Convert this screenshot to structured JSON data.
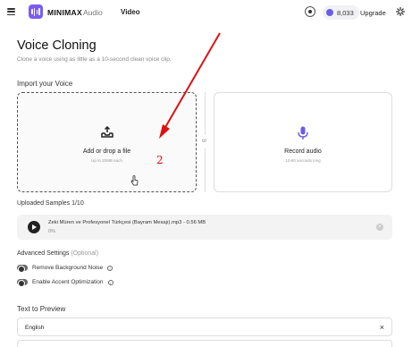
{
  "header": {
    "brand": "MINIMAX",
    "product": "Audio",
    "nav_video": "Video",
    "credits": "8,033",
    "upgrade_label": "Upgrade"
  },
  "page": {
    "title": "Voice Cloning",
    "subtitle": "Clone a voice using as little as a 10-second clean voice clip."
  },
  "import": {
    "label": "Import your Voice",
    "upload_title": "Add or drop a file",
    "upload_sub": "Up to 20MB each",
    "or_text": "or",
    "record_title": "Record audio",
    "record_sub": "10-60 seconds long"
  },
  "annotation": {
    "number": "2",
    "color": "#dd1111"
  },
  "uploaded": {
    "label": "Uploaded Samples  1/10",
    "file_name": "Zeki Müren ve Profesyonel Türkçesi (Bayram Mesajı).mp3 - 0.56 MB",
    "progress_text": "0%"
  },
  "advanced": {
    "label": "Advanced Settings",
    "optional": "(Optional)",
    "option1": "Remove Background Noise",
    "option2": "Enable Accent Optimization"
  },
  "preview": {
    "label": "Text to Preview",
    "language": "English",
    "clear_icon": "×"
  },
  "colors": {
    "accent": "#7a5cf2",
    "record_icon": "#6b5ce7"
  }
}
